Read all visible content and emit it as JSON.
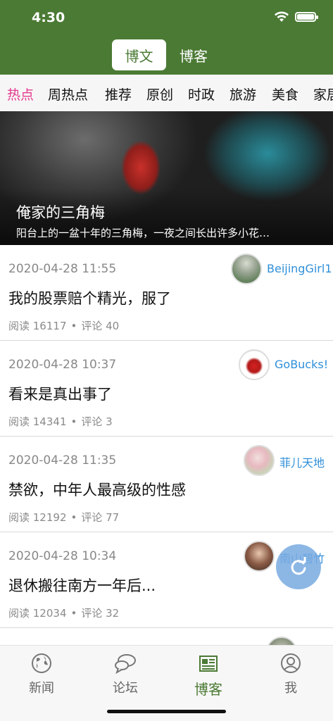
{
  "status_bar": {
    "time": "4:30"
  },
  "header": {
    "segments": [
      {
        "label": "博文",
        "active": true
      },
      {
        "label": "博客",
        "active": false
      }
    ],
    "accent_color": "#4b7a34"
  },
  "categories": [
    {
      "label": "热点",
      "active": true
    },
    {
      "label": "周热点"
    },
    {
      "label": "推荐"
    },
    {
      "label": "原创"
    },
    {
      "label": "时政"
    },
    {
      "label": "旅游"
    },
    {
      "label": "美食"
    },
    {
      "label": "家居"
    }
  ],
  "banner": {
    "title": "俺家的三角梅",
    "subtitle": "阳台上的一盆十年的三角梅，一夜之间长出许多小花…"
  },
  "posts": [
    {
      "date": "2020-04-28 11:55",
      "title": "我的股票赔个精光，服了",
      "reads_label": "阅读 16117",
      "comments_label": "评论 40",
      "author": "BeijingGirl1"
    },
    {
      "date": "2020-04-28 10:37",
      "title": "看来是真出事了",
      "reads_label": "阅读 14341",
      "comments_label": "评论 3",
      "author": "GoBucks!"
    },
    {
      "date": "2020-04-28 11:35",
      "title": "禁欲，中年人最高级的性感",
      "reads_label": "阅读 12192",
      "comments_label": "评论 77",
      "author": "菲儿天地"
    },
    {
      "date": "2020-04-28 10:34",
      "title": "退休搬往南方一年后...",
      "reads_label": "阅读 12034",
      "comments_label": "评论 32",
      "author": "南山碧竹"
    }
  ],
  "tabbar": {
    "items": [
      {
        "label": "新闻",
        "icon": "globe-icon"
      },
      {
        "label": "论坛",
        "icon": "chat-bubbles-icon"
      },
      {
        "label": "博客",
        "icon": "newspaper-icon",
        "active": true
      },
      {
        "label": "我",
        "icon": "person-icon"
      }
    ]
  },
  "colors": {
    "active_category": "#e53b8e",
    "author_link": "#2f8fd9"
  }
}
